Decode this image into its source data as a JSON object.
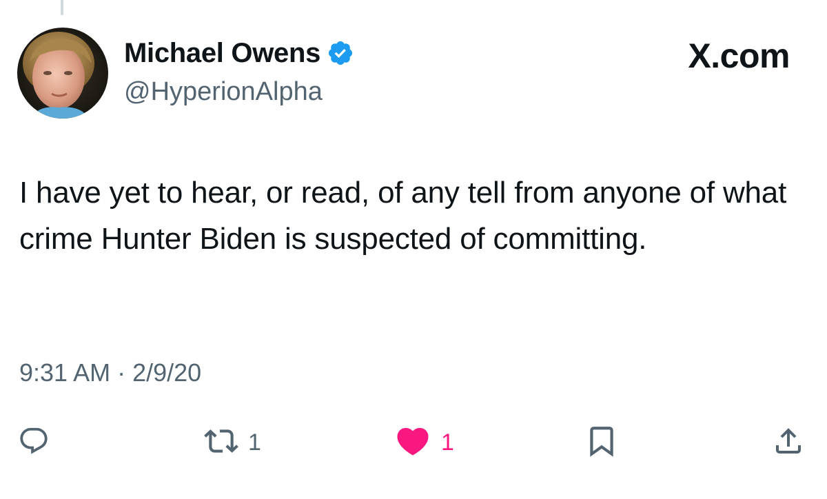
{
  "author": {
    "display_name": "Michael Owens",
    "handle": "@HyperionAlpha",
    "verified": true
  },
  "brand": {
    "label": "X.com"
  },
  "tweet": {
    "text": "I have yet to hear, or read, of any tell from anyone of what crime Hunter Biden is suspected of committing.",
    "timestamp": "9:31 AM · 2/9/20"
  },
  "actions": {
    "reply": {
      "icon": "reply-icon",
      "count": ""
    },
    "retweet": {
      "icon": "retweet-icon",
      "count": "1"
    },
    "like": {
      "icon": "heart-icon",
      "count": "1",
      "active": true
    },
    "bookmark": {
      "icon": "bookmark-icon"
    },
    "share": {
      "icon": "share-icon"
    }
  },
  "colors": {
    "text_primary": "#0f1419",
    "text_secondary": "#536471",
    "verified_blue": "#1d9bf0",
    "like_pink": "#f91880"
  }
}
